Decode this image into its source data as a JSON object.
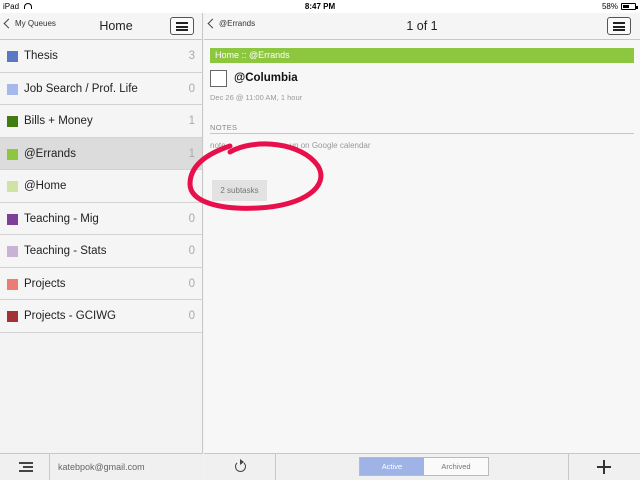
{
  "status_bar": {
    "device": "iPad",
    "time": "8:47 PM",
    "battery": "58%",
    "battery_level": 0.58
  },
  "left_pane": {
    "back_label": "My Queues",
    "title": "Home",
    "queues": [
      {
        "name": "Thesis",
        "count": "3",
        "color": "#5b78c5",
        "selected": false
      },
      {
        "name": "Job Search / Prof. Life",
        "count": "0",
        "color": "#a6b8ec",
        "selected": false
      },
      {
        "name": "Bills + Money",
        "count": "1",
        "color": "#3f7d12",
        "selected": false
      },
      {
        "name": "@Errands",
        "count": "1",
        "color": "#8dc63f",
        "selected": true
      },
      {
        "name": "@Home",
        "count": "",
        "color": "#cfe3a6",
        "selected": false
      },
      {
        "name": "Teaching - Mig",
        "count": "0",
        "color": "#7d3f98",
        "selected": false
      },
      {
        "name": "Teaching - Stats",
        "count": "0",
        "color": "#c9b3d4",
        "selected": false
      },
      {
        "name": "Projects",
        "count": "0",
        "color": "#ec7b72",
        "selected": false
      },
      {
        "name": "Projects - GCIWG",
        "count": "0",
        "color": "#a33234",
        "selected": false
      }
    ],
    "footer_email": "katebpok@gmail.com"
  },
  "right_pane": {
    "back_label": "@Errands",
    "title": "1 of 1",
    "breadcrumb": "Home :: @Errands",
    "task": {
      "title": "@Columbia",
      "meta": "Dec 26 @ 11:00 AM, 1 hour",
      "notes_label": "NOTES",
      "notes_text_left": "note",
      "notes_text_right": "up on Google calendar",
      "subtasks_label": "2 subtasks"
    },
    "footer": {
      "active_label": "Active",
      "archived_label": "Archived"
    }
  },
  "annotation_color": "#e8104a"
}
